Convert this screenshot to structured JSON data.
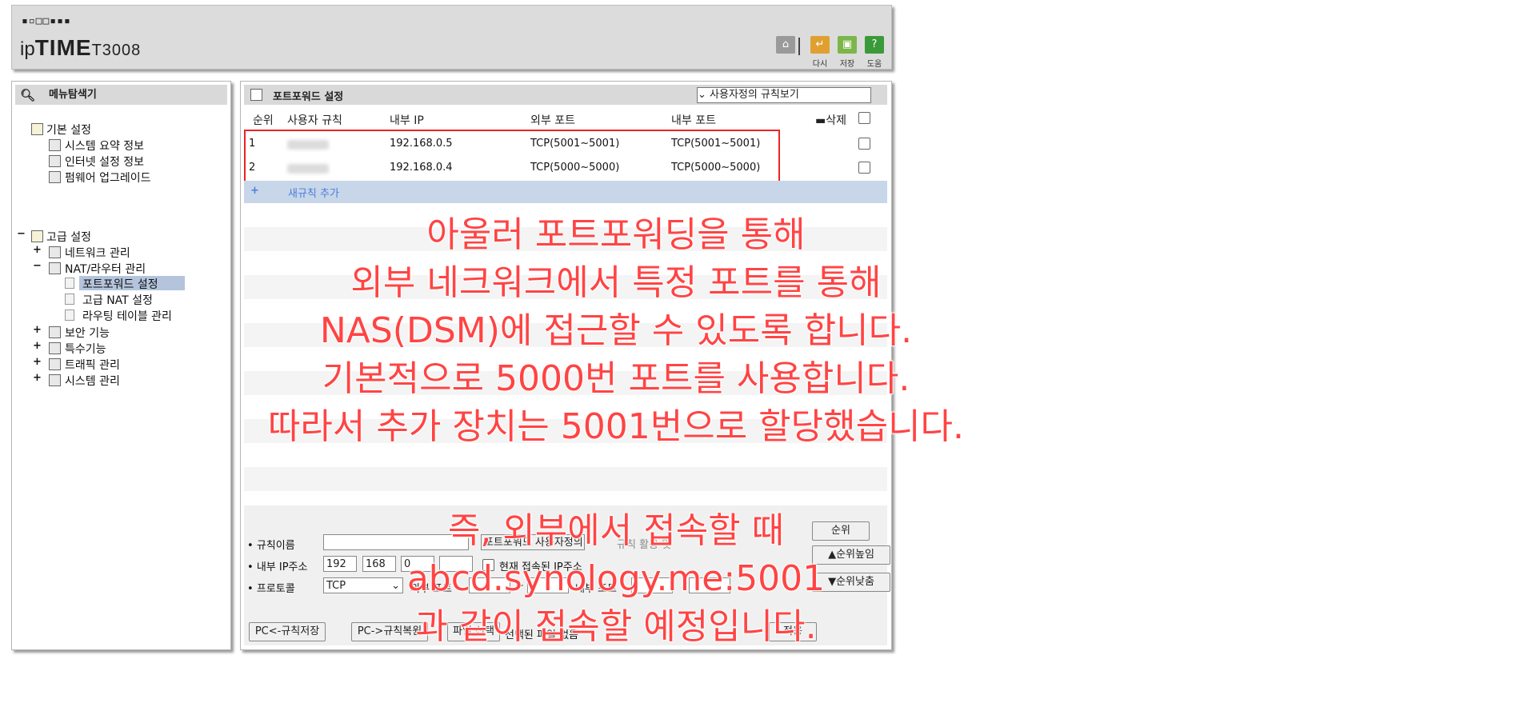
{
  "header": {
    "logo_dots": "▪▫□□▪▪▪",
    "brand_ip": "ip",
    "brand_time": "TIME",
    "brand_model": "T3008",
    "tools": [
      {
        "name": "home",
        "label": "",
        "color": "#8c8c8c",
        "glyph": "⌂"
      },
      {
        "name": "back",
        "label": "다시",
        "color": "#e0a030",
        "glyph": "↵"
      },
      {
        "name": "save",
        "label": "저장",
        "color": "#7cb64a",
        "glyph": "▣"
      },
      {
        "name": "help",
        "label": "도움",
        "color": "#3a9a3a",
        "glyph": "?"
      }
    ]
  },
  "menu": {
    "title": "메뉴탐색기",
    "basic": {
      "label": "기본 설정",
      "items": [
        "시스템 요약 정보",
        "인터넷 설정 정보",
        "펌웨어 업그레이드"
      ]
    },
    "advanced": {
      "toggle": "−",
      "label": "고급 설정",
      "network": "네트워크 관리",
      "nat": "NAT/라우터 관리",
      "nat_items": [
        "포트포워드 설정",
        "고급 NAT 설정",
        "라우팅 테이블 관리"
      ],
      "others": [
        "보안 기능",
        "특수기능",
        "트래픽 관리",
        "시스템 관리"
      ]
    }
  },
  "portforward": {
    "title": "포트포워드 설정",
    "view_select": "사용자정의 규칙보기",
    "columns": [
      "순위",
      "사용자 규칙",
      "내부 IP",
      "외부 포트",
      "내부 포트",
      "삭제"
    ],
    "rules": [
      {
        "rank": "1",
        "ip": "192.168.0.5",
        "ext": "TCP(5001~5001)",
        "int": "TCP(5001~5001)"
      },
      {
        "rank": "2",
        "ip": "192.168.0.4",
        "ext": "TCP(5000~5000)",
        "int": "TCP(5000~5000)"
      }
    ],
    "add_rule": "새규칙 추가",
    "add_plus": "+"
  },
  "form": {
    "rule_name_label": "규칙이름",
    "rule_select": "포트포워드 사용자정의",
    "rule_extra": "규칙 활용 및",
    "order_btn": "순위",
    "ip_label": "내부 IP주소",
    "ip": [
      "192",
      "168",
      "0",
      ""
    ],
    "current_ip": "현재 접속된 IP주소",
    "order_up": "▲순위높임",
    "protocol_label": "프로토콜",
    "protocol": "TCP",
    "ext_port_label": "외부 포트",
    "tilde": "~",
    "int_port_label": "내부 포트",
    "order_down": "▼순위낮춤",
    "save_pc": "PC<-규칙저장",
    "restore_pc": "PC->규칙복원",
    "file_select": "파일 선택",
    "selected_file": "선택된 파일 없음",
    "apply": "적용"
  },
  "annotation": {
    "lines1": [
      "아울러 포트포워딩을 통해",
      "외부 네크워크에서 특정 포트를 통해",
      "NAS(DSM)에 접근할 수 있도록 합니다.",
      "기본적으로 5000번 포트를 사용합니다.",
      "따라서 추가 장치는 5001번으로 할당했습니다."
    ],
    "lines2": [
      "즉, 외부에서 접속할 때",
      "abcd.synology.me:5001",
      "과 같이 접속할 예정입니다."
    ],
    "color": "#ff4444"
  }
}
